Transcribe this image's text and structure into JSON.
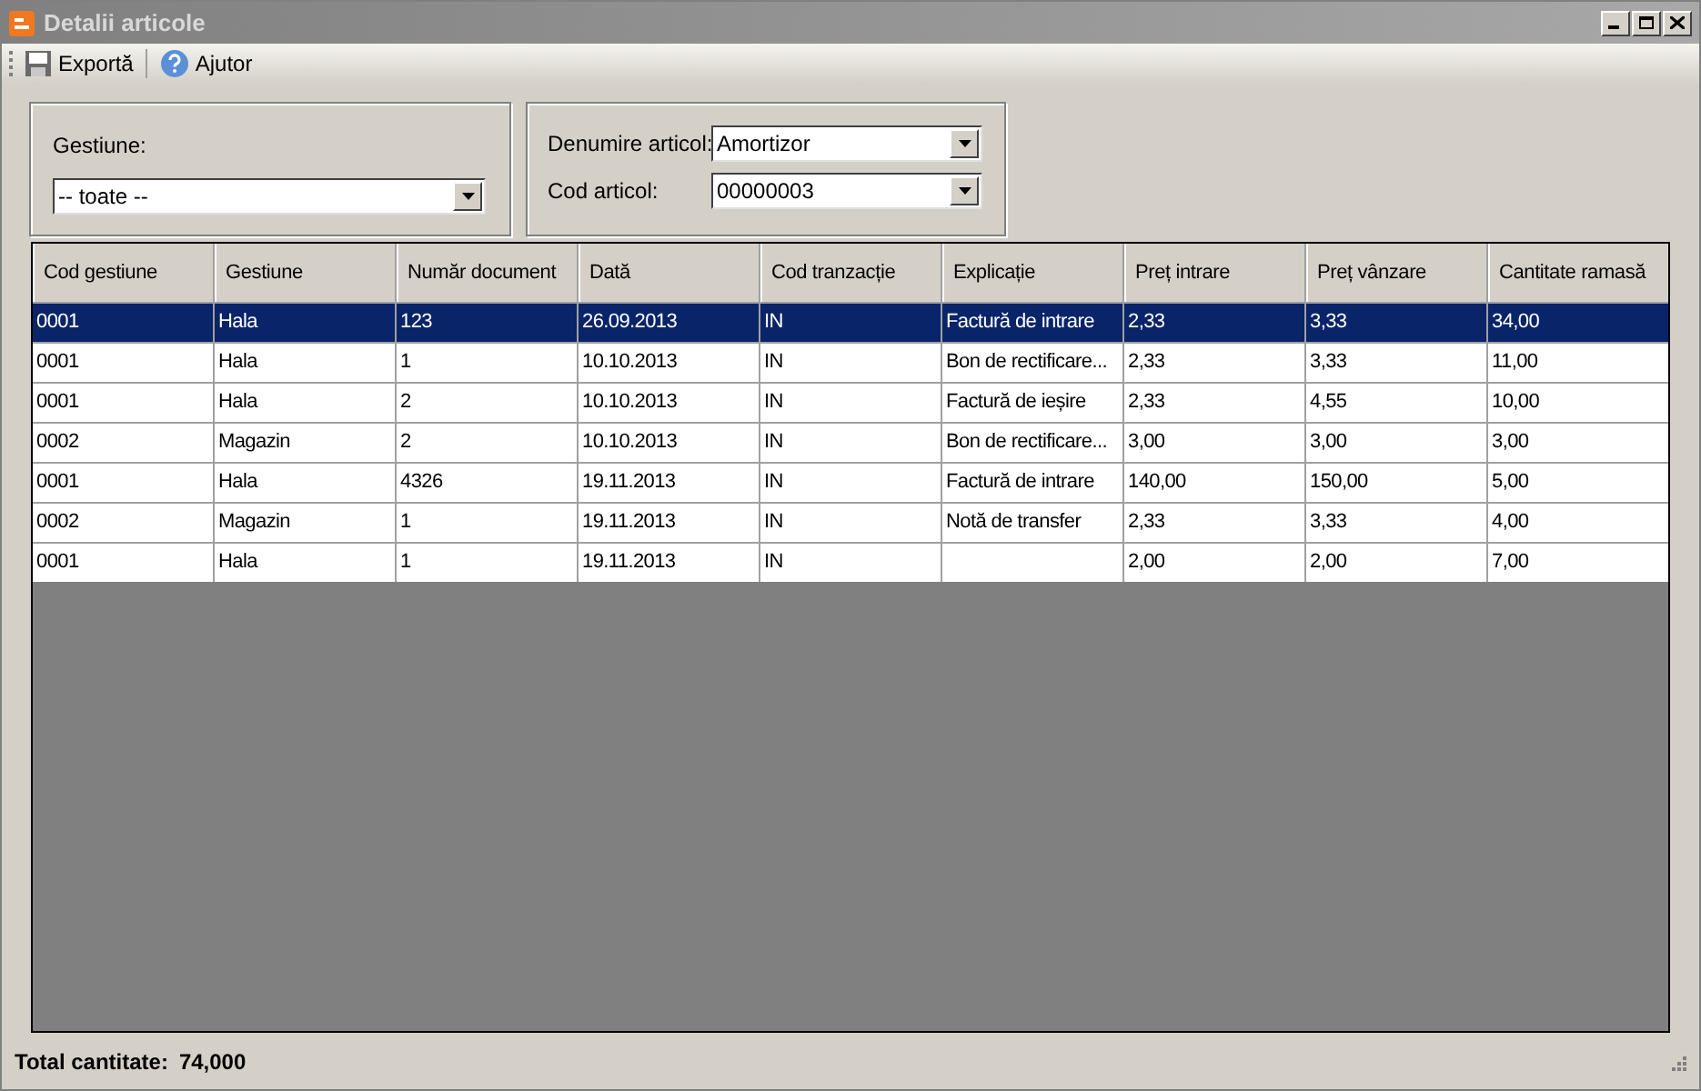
{
  "window": {
    "title": "Detalii articole"
  },
  "toolbar": [
    {
      "kind": "save",
      "label": "Exportă"
    },
    {
      "kind": "help",
      "label": "Ajutor"
    }
  ],
  "filters": {
    "gestiune": {
      "label": "Gestiune:",
      "value": "-- toate --"
    },
    "denumire": {
      "label": "Denumire articol:",
      "value": "Amortizor"
    },
    "cod": {
      "label": "Cod articol:",
      "value": "00000003"
    }
  },
  "table": {
    "columns": [
      "Cod gestiune",
      "Gestiune",
      "Număr document",
      "Dată",
      "Cod tranzacție",
      "Explicație",
      "Preț intrare",
      "Preț vânzare",
      "Cantitate ramasă"
    ],
    "rows": [
      {
        "selected": true,
        "cells": [
          "0001",
          "Hala",
          "123",
          "26.09.2013",
          "IN",
          "Factură de intrare",
          "2,33",
          "3,33",
          "34,00"
        ]
      },
      {
        "selected": false,
        "cells": [
          "0001",
          "Hala",
          "1",
          "10.10.2013",
          "IN",
          "Bon de rectificare...",
          "2,33",
          "3,33",
          "11,00"
        ]
      },
      {
        "selected": false,
        "cells": [
          "0001",
          "Hala",
          "2",
          "10.10.2013",
          "IN",
          "Factură de ieșire",
          "2,33",
          "4,55",
          "10,00"
        ]
      },
      {
        "selected": false,
        "cells": [
          "0002",
          "Magazin",
          "2",
          "10.10.2013",
          "IN",
          "Bon de rectificare...",
          "3,00",
          "3,00",
          "3,00"
        ]
      },
      {
        "selected": false,
        "cells": [
          "0001",
          "Hala",
          "4326",
          "19.11.2013",
          "IN",
          "Factură de intrare",
          "140,00",
          "150,00",
          "5,00"
        ]
      },
      {
        "selected": false,
        "cells": [
          "0002",
          "Magazin",
          "1",
          "19.11.2013",
          "IN",
          "Notă de transfer",
          "2,33",
          "3,33",
          "4,00"
        ]
      },
      {
        "selected": false,
        "cells": [
          "0001",
          "Hala",
          "1",
          "19.11.2013",
          "IN",
          "",
          "2,00",
          "2,00",
          "7,00"
        ]
      }
    ]
  },
  "status_bar": {
    "label": "Total cantitate:",
    "value": "74,000"
  }
}
